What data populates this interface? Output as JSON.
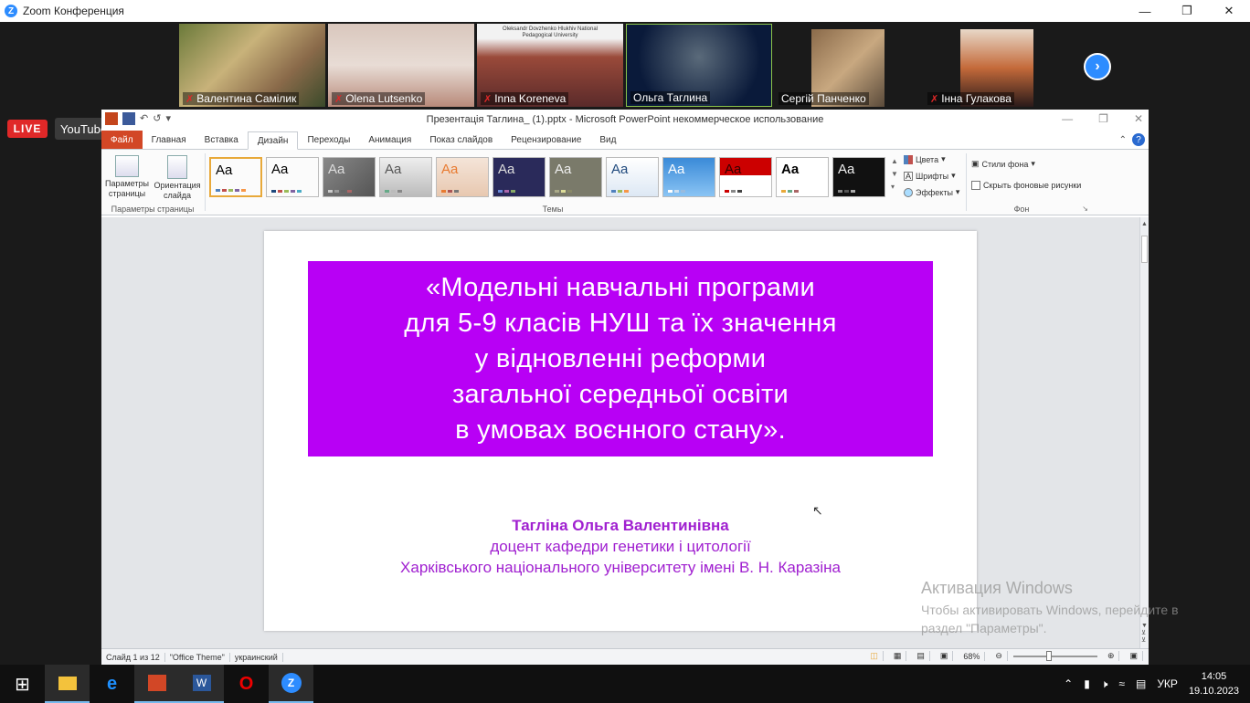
{
  "zoom": {
    "title": "Zoom Конференция",
    "participants": [
      {
        "name": "Валентина Самілик",
        "muted": true
      },
      {
        "name": "Olena Lutsenko",
        "muted": true
      },
      {
        "name": "Inna Koreneva",
        "muted": true
      },
      {
        "name": "Ольга Таглина",
        "muted": false
      },
      {
        "name": "Сергій Панченко",
        "muted": false
      },
      {
        "name": "Інна Гулакова",
        "muted": true
      }
    ],
    "live_label": "LIVE",
    "youtube_label": "YouTube",
    "tile3_banner": "Oleksandr Dovzhenko Hlukhiv National Pedagogical University"
  },
  "ppt": {
    "window_title": "Презентація Таглина_ (1).pptx - Microsoft PowerPoint некоммерческое использование",
    "tabs": [
      "Файл",
      "Главная",
      "Вставка",
      "Дизайн",
      "Переходы",
      "Анимация",
      "Показ слайдов",
      "Рецензирование",
      "Вид"
    ],
    "ribbon": {
      "page_setup": "Параметры страницы",
      "orientation": "Ориентация слайда",
      "group_page": "Параметры страницы",
      "group_themes": "Темы",
      "theme_sample": "Aa",
      "colors": "Цвета",
      "fonts": "Шрифты",
      "effects": "Эффекты",
      "bg_styles": "Стили фона",
      "hide_bg": "Скрыть фоновые рисунки",
      "group_bg": "Фон"
    },
    "slide": {
      "title_lines": [
        "«Модельні навчальні програми",
        "для 5-9 класів НУШ  та їх значення",
        "у відновленні реформи",
        "загальної середньої освіти",
        "в умовах воєнного стану»."
      ],
      "author_name": "Тагліна Ольга Валентинівна",
      "author_position": "доцент кафедри генетики і цитології",
      "author_university": "Харківського національного університету імені В. Н. Каразіна"
    },
    "status": {
      "slide_num": "Слайд 1 из 12",
      "theme": "\"Office Theme\"",
      "lang": "украинский",
      "zoom": "68%"
    }
  },
  "activation": {
    "title": "Активация Windows",
    "text": "Чтобы активировать Windows, перейдите в раздел \"Параметры\"."
  },
  "taskbar": {
    "lang": "УКР",
    "time": "14:05",
    "date": "19.10.2023"
  },
  "colors": {
    "title_bg": "#b800f5",
    "author_text": "#a020d0",
    "zoom_blue": "#2d8cff"
  }
}
